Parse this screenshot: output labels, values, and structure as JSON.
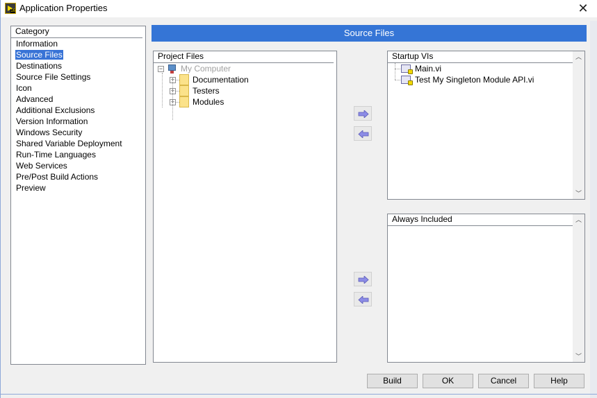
{
  "window": {
    "title": "Application Properties",
    "icon": "labview-app-icon",
    "icon_badge": "16",
    "close_icon": "close-icon"
  },
  "category": {
    "header": "Category",
    "selected_index": 1,
    "items": [
      {
        "label": "Information"
      },
      {
        "label": "Source Files"
      },
      {
        "label": "Destinations"
      },
      {
        "label": "Source File Settings"
      },
      {
        "label": "Icon"
      },
      {
        "label": "Advanced"
      },
      {
        "label": "Additional Exclusions"
      },
      {
        "label": "Version Information"
      },
      {
        "label": "Windows Security"
      },
      {
        "label": "Shared Variable Deployment"
      },
      {
        "label": "Run-Time Languages"
      },
      {
        "label": "Web Services"
      },
      {
        "label": "Pre/Post Build Actions"
      },
      {
        "label": "Preview"
      }
    ]
  },
  "banner": {
    "title": "Source Files",
    "color": "#3575d6"
  },
  "project_files": {
    "header": "Project Files",
    "root": {
      "label": "My Computer",
      "expanded": true,
      "icon": "computer-icon",
      "disabled": true
    },
    "children": [
      {
        "label": "Documentation",
        "icon": "folder-icon",
        "expanded": false
      },
      {
        "label": "Testers",
        "icon": "folder-icon",
        "expanded": false
      },
      {
        "label": "Modules",
        "icon": "folder-icon",
        "expanded": false
      }
    ]
  },
  "transfer_buttons": {
    "startup_add": "arrow-right-icon",
    "startup_remove": "arrow-left-icon",
    "always_add": "arrow-right-icon",
    "always_remove": "arrow-left-icon"
  },
  "startup_vis": {
    "header": "Startup VIs",
    "items": [
      {
        "label": "Main.vi",
        "icon": "vi-icon"
      },
      {
        "label": "Test My Singleton Module API.vi",
        "icon": "vi-icon"
      }
    ]
  },
  "always_included": {
    "header": "Always Included",
    "items": []
  },
  "buttons": {
    "build": "Build",
    "ok": "OK",
    "cancel": "Cancel",
    "help": "Help"
  }
}
